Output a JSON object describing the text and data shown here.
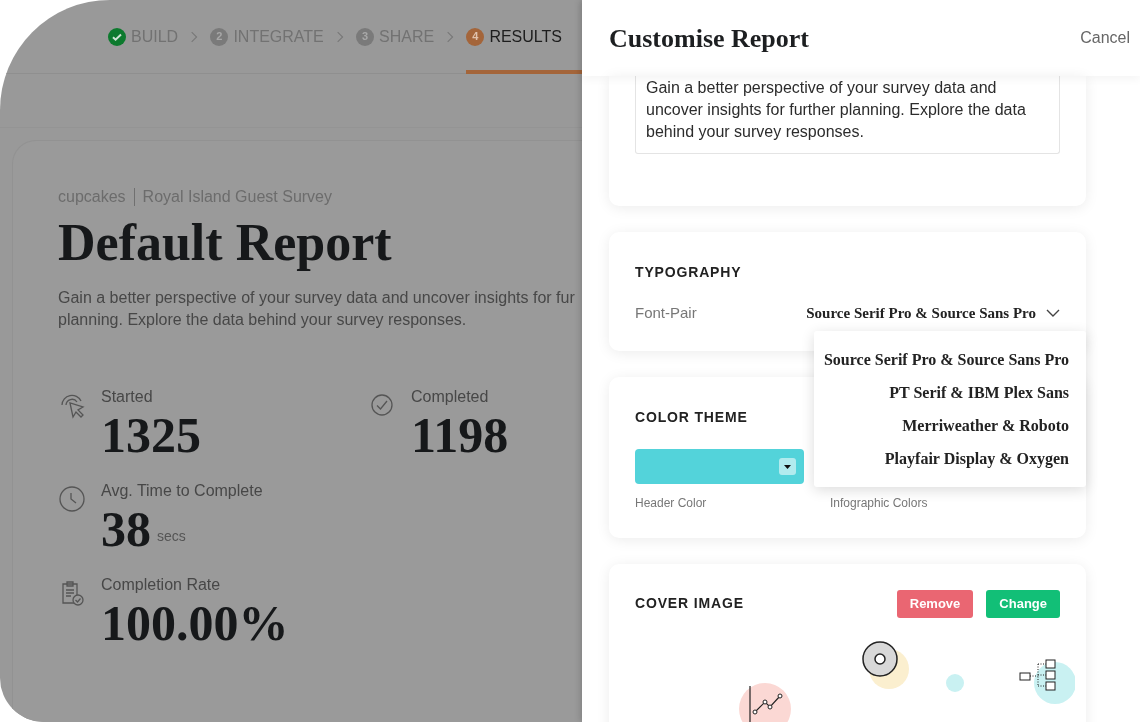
{
  "steps": [
    {
      "label": "BUILD",
      "kind": "done"
    },
    {
      "number": "2",
      "label": "INTEGRATE",
      "kind": "todo"
    },
    {
      "number": "3",
      "label": "SHARE",
      "kind": "todo"
    },
    {
      "number": "4",
      "label": "RESULTS",
      "kind": "current"
    }
  ],
  "report": {
    "workspace": "cupcakes",
    "survey": "Royal Island Guest Survey",
    "title": "Default Report",
    "description_lines": [
      "Gain a better perspective of your survey data and uncover insights for fur",
      "planning. Explore the data behind your survey responses."
    ]
  },
  "stats": [
    {
      "kind": "cursor",
      "label": "Started",
      "value": "1325"
    },
    {
      "kind": "check",
      "label": "Completed",
      "value": "1198"
    },
    {
      "kind": "clock",
      "label": "Avg. Time to Complete",
      "value": "38",
      "unit": "secs"
    },
    {
      "kind": "clipboard",
      "label": "Completion Rate",
      "value": "100.00%"
    }
  ],
  "panel": {
    "title": "Customise Report",
    "cancel": "Cancel",
    "description": "Gain a better perspective of your survey data and uncover insights for further planning. Explore the data behind your survey responses.",
    "typography": {
      "heading": "TYPOGRAPHY",
      "label": "Font-Pair",
      "value": "Source Serif Pro & Source Sans Pro",
      "expanded": true,
      "options": [
        "Source Serif Pro & Source Sans Pro",
        "PT Serif & IBM Plex Sans",
        "Merriweather & Roboto",
        "Playfair Display & Oxygen"
      ]
    },
    "color_theme": {
      "heading": "COLOR THEME",
      "header_color": {
        "label": "Header Color",
        "color": "#53d3da"
      },
      "infographic_label": "Infographic Colors"
    },
    "cover_image": {
      "heading": "COVER IMAGE",
      "buttons": [
        {
          "label": "Remove",
          "kind": "danger"
        },
        {
          "label": "Change",
          "kind": "primary"
        }
      ]
    }
  }
}
